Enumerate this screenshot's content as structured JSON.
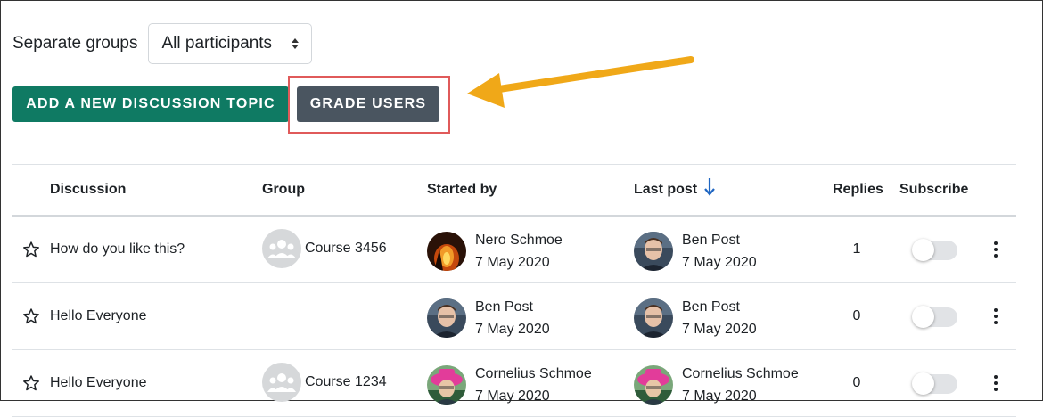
{
  "filter": {
    "label": "Separate groups",
    "selected": "All participants"
  },
  "actions": {
    "add_topic": "ADD A NEW DISCUSSION TOPIC",
    "grade_users": "GRADE USERS"
  },
  "colors": {
    "add_button": "#0f7a63",
    "grade_button": "#4a5560",
    "highlight_box": "#e05a5a",
    "annotation_arrow": "#f0a818",
    "sort_indicator": "#1f66c2"
  },
  "table": {
    "headers": {
      "discussion": "Discussion",
      "group": "Group",
      "started_by": "Started by",
      "last_post": "Last post",
      "replies": "Replies",
      "subscribe": "Subscribe"
    },
    "sort_icon": "arrow-down-icon",
    "rows": [
      {
        "title": "How do you like this?",
        "group": "Course 3456",
        "started_by": {
          "name": "Nero Schmoe",
          "date": "7 May 2020"
        },
        "last_post": {
          "name": "Ben Post",
          "date": "7 May 2020"
        },
        "replies": "1",
        "subscribed": false
      },
      {
        "title": "Hello Everyone",
        "group": "",
        "started_by": {
          "name": "Ben Post",
          "date": "7 May 2020"
        },
        "last_post": {
          "name": "Ben Post",
          "date": "7 May 2020"
        },
        "replies": "0",
        "subscribed": false
      },
      {
        "title": "Hello Everyone",
        "group": "Course 1234",
        "started_by": {
          "name": "Cornelius Schmoe",
          "date": "7 May 2020"
        },
        "last_post": {
          "name": "Cornelius Schmoe",
          "date": "7 May 2020"
        },
        "replies": "0",
        "subscribed": false
      }
    ]
  }
}
